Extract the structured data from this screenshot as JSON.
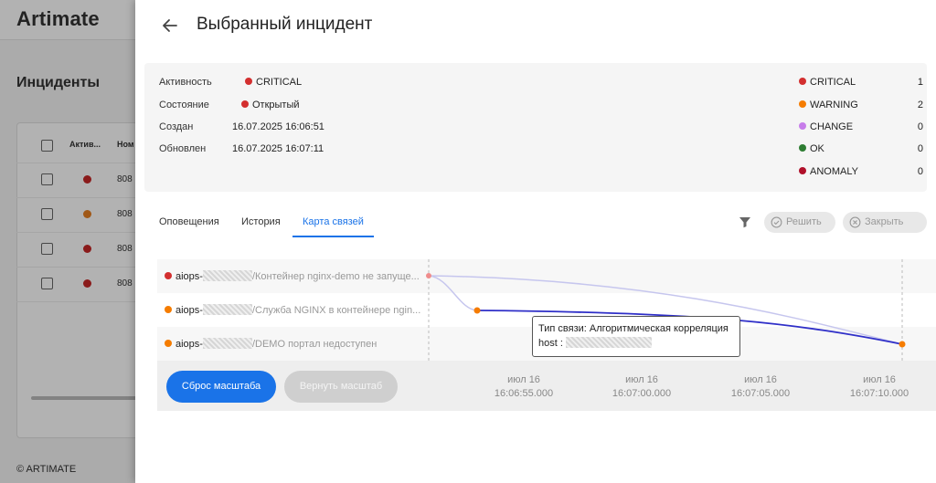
{
  "background": {
    "logo": "Artimate",
    "title": "Инциденты",
    "columns": [
      "Актив...",
      "Ном"
    ],
    "rows": [
      {
        "num": "808",
        "color": "#c62828"
      },
      {
        "num": "808",
        "color": "#e67e22"
      },
      {
        "num": "808",
        "color": "#c62828"
      },
      {
        "num": "808",
        "color": "#c62828"
      }
    ],
    "footer": "© ARTIMATE"
  },
  "drawer": {
    "title": "Выбранный инцидент",
    "info": {
      "activity_label": "Активность",
      "activity_value": "CRITICAL",
      "state_label": "Состояние",
      "state_value": "Открытый",
      "created_label": "Создан",
      "created_value": "16.07.2025 16:06:51",
      "updated_label": "Обновлен",
      "updated_value": "16.07.2025 16:07:11"
    },
    "stats": [
      {
        "name": "CRITICAL",
        "count": "1",
        "color": "#d32f2f"
      },
      {
        "name": "WARNING",
        "count": "2",
        "color": "#f57c00"
      },
      {
        "name": "CHANGE",
        "count": "0",
        "color": "#c77dea"
      },
      {
        "name": "OK",
        "count": "0",
        "color": "#2e7d32"
      },
      {
        "name": "ANOMALY",
        "count": "0",
        "color": "#b0102a"
      }
    ],
    "tabs": [
      "Оповещения",
      "История",
      "Карта связей"
    ],
    "active_tab": "Карта связей",
    "resolve_label": "Решить",
    "close_label": "Закрыть"
  },
  "timeline": {
    "rows": [
      {
        "host": "aiops-",
        "path": "/Контейнер nginx-demo не запуще...",
        "color": "#d32f2f"
      },
      {
        "host": "aiops-",
        "path": "/Служба NGINX в контейнере ngin...",
        "color": "#f57c00"
      },
      {
        "host": "aiops-",
        "path": "/DEMO портал недоступен",
        "color": "#f57c00"
      }
    ],
    "ticks": [
      {
        "date": "июл 16",
        "time": "16:06:55.000"
      },
      {
        "date": "июл 16",
        "time": "16:07:00.000"
      },
      {
        "date": "июл 16",
        "time": "16:07:05.000"
      },
      {
        "date": "июл 16",
        "time": "16:07:10.000"
      }
    ],
    "tooltip_line1": "Тип связи: Алгоритмическая корреляция",
    "tooltip_line2": "host :",
    "reset_zoom_label": "Сброс масштаба",
    "restore_zoom_label": "Вернуть масштаб"
  }
}
